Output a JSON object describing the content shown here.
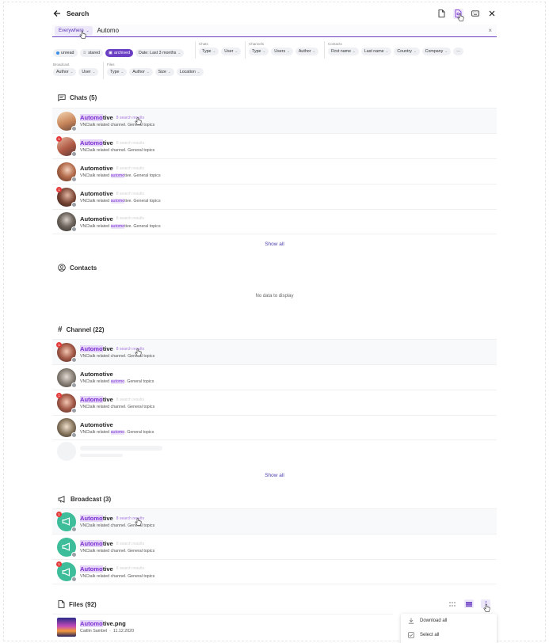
{
  "header": {
    "title": "Search",
    "icons": [
      "file-icon",
      "file-search-icon",
      "keyboard-icon",
      "close-icon"
    ]
  },
  "search": {
    "scope": "Everywhere",
    "query": "Automo"
  },
  "filters": {
    "general": {
      "unread": "unread",
      "stared": "stared",
      "archived": "archived",
      "date": "Date: Last 3 months"
    },
    "chats": {
      "label": "Chats",
      "type": "Type",
      "user": "User"
    },
    "channels": {
      "label": "Channels",
      "type": "Type",
      "users": "Users",
      "author": "Author"
    },
    "contacts": {
      "label": "Contacts",
      "first_name": "First name",
      "last_name": "Last name",
      "country": "Country",
      "company": "Company",
      "more": "···"
    },
    "broadcast": {
      "label": "Broadcast",
      "author": "Author",
      "user": "User"
    },
    "files": {
      "label": "Files",
      "type": "Type",
      "author": "Author",
      "size": "Size",
      "location": "Location"
    }
  },
  "chats": {
    "title": "Chats (5)",
    "items": [
      {
        "name_hl": "Automo",
        "name_rest": "tive",
        "hits": "8 search results",
        "sub_pre": "VNCtalk related channel. General topics",
        "sub_hl": "",
        "sub_post": "",
        "badge": ""
      },
      {
        "name_hl": "Automo",
        "name_rest": "tive",
        "hits": "8 search results",
        "sub_pre": "VNCtalk related channel. General topics",
        "sub_hl": "",
        "sub_post": "",
        "badge": "1"
      },
      {
        "name_hl": "",
        "name_rest": "Automotive",
        "hits": "8 search results",
        "sub_pre": "VNCtalk related ",
        "sub_hl": "automo",
        "sub_post": "tive. General topics",
        "badge": ""
      },
      {
        "name_hl": "",
        "name_rest": "Automotive",
        "hits": "8 search results",
        "sub_pre": "VNCtalk related ",
        "sub_hl": "automo",
        "sub_post": "tive. General topics",
        "badge": "1"
      },
      {
        "name_hl": "",
        "name_rest": "Automotive",
        "hits": "8 search results",
        "sub_pre": "VNCtalk related ",
        "sub_hl": "automo",
        "sub_post": "tive. General topics",
        "badge": ""
      }
    ],
    "show_all": "Show all"
  },
  "contacts": {
    "title": "Contacts",
    "empty": "No data to display"
  },
  "channels": {
    "title": "Channel (22)",
    "items": [
      {
        "name_hl": "Automo",
        "name_rest": "tive",
        "hits": "8 search results",
        "sub_pre": "VNCtalk related channel. General topics",
        "sub_hl": "",
        "sub_post": "",
        "badge": "1"
      },
      {
        "name_hl": "",
        "name_rest": "Automotive",
        "hits": "",
        "sub_pre": "VNCtalk related ",
        "sub_hl": "automo",
        "sub_post": ". General topics",
        "badge": ""
      },
      {
        "name_hl": "Automo",
        "name_rest": "tive",
        "hits": "8 search results",
        "sub_pre": "VNCtalk related channel. General topics",
        "sub_hl": "",
        "sub_post": "",
        "badge": "1"
      },
      {
        "name_hl": "",
        "name_rest": "Automotive",
        "hits": "",
        "sub_pre": "VNCtalk related ",
        "sub_hl": "automo",
        "sub_post": ". General topics",
        "badge": ""
      }
    ],
    "show_all": "Show all"
  },
  "broadcast": {
    "title": "Broadcast (3)",
    "items": [
      {
        "name_hl": "Automo",
        "name_rest": "tive",
        "hits": "8 search results",
        "sub_pre": "VNCtalk related channel. General topics",
        "badge": "1"
      },
      {
        "name_hl": "Automo",
        "name_rest": "tive",
        "hits": "8 search results",
        "sub_pre": "VNCtalk related channel. General topics",
        "badge": ""
      },
      {
        "name_hl": "Automo",
        "name_rest": "tive",
        "hits": "8 search results",
        "sub_pre": "VNCtalk related channel. General topics",
        "badge": "1"
      }
    ]
  },
  "files": {
    "title": "Files (92)",
    "item": {
      "name_hl": "Automo",
      "name_rest": "tive.png",
      "author": "Caitlin Sambel",
      "date": "11.12.2020"
    },
    "menu": {
      "download_all": "Download all",
      "select_all": "Select all"
    }
  },
  "colors": {
    "accent": "#6b3fc4",
    "highlight": "#e7d6fb",
    "link": "#4a3fb0",
    "broadcast": "#3dbd9a"
  }
}
